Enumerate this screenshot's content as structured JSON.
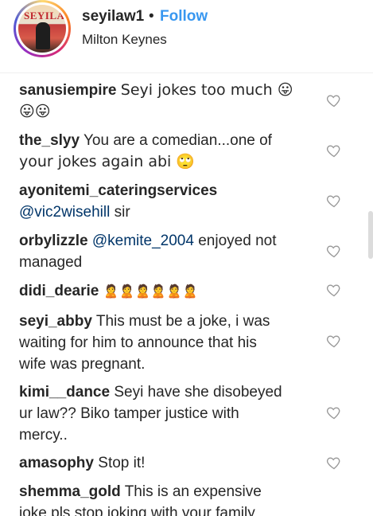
{
  "header": {
    "username": "seyilaw1",
    "separator": "•",
    "follow_label": "Follow",
    "location": "Milton Keynes",
    "avatar_logo_text": "SEYILAW"
  },
  "comments": [
    {
      "user": "sanusiempire",
      "text": "Seyi jokes too much 😛",
      "cont": "😛😛"
    },
    {
      "user": "the_slyy",
      "text": "You are a comedian...one of",
      "cont": "your jokes again abi 🙄"
    },
    {
      "user": "ayonitemi_cateringservices",
      "mention": "@vic2wisehill",
      "text": " sir"
    },
    {
      "user": "orbylizzle",
      "mention": "@kemite_2004",
      "text": " enjoyed not",
      "cont": "managed"
    },
    {
      "user": "didi_dearie",
      "text": "🙎🙎🙎🙎🙎🙎"
    },
    {
      "user": "seyi_abby",
      "text": "This must be a joke, i was",
      "cont": "waiting for him to announce that his",
      "cont2": "wife was pregnant."
    },
    {
      "user": "kimi__dance",
      "text": "Seyi have she disobeyed",
      "cont": "ur law?? Biko tamper justice with",
      "cont2": "mercy.."
    },
    {
      "user": "amasophy",
      "text": "Stop it!"
    },
    {
      "user": "shemma_gold",
      "text": "This is an expensive",
      "cont": "joke pls stop joking with your family"
    }
  ],
  "colors": {
    "follow": "#3897f0",
    "mention": "#003569",
    "text": "#262626"
  },
  "icons": {
    "like": "heart-outline-icon"
  }
}
